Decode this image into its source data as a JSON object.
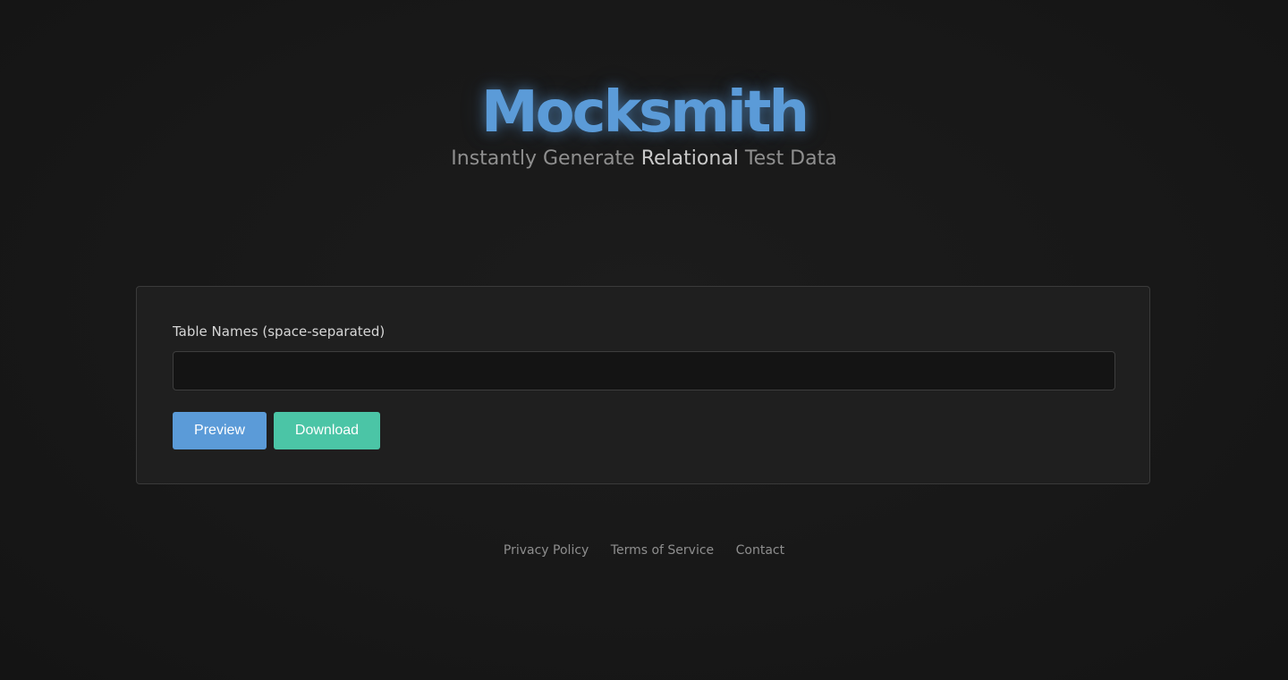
{
  "header": {
    "brand": "Mocksmith",
    "tagline_prefix": "Instantly Generate ",
    "tagline_emphasis": "Relational",
    "tagline_suffix": " Test Data"
  },
  "form": {
    "table_names_label": "Table Names (space-separated)",
    "table_names_value": "",
    "table_names_placeholder": "",
    "preview_label": "Preview",
    "download_label": "Download"
  },
  "footer": {
    "links": [
      "Privacy Policy",
      "Terms of Service",
      "Contact"
    ]
  },
  "colors": {
    "accent_blue": "#5b9bd8",
    "accent_teal": "#4bc5a6",
    "background": "#181818",
    "card": "#1f1f1f"
  }
}
